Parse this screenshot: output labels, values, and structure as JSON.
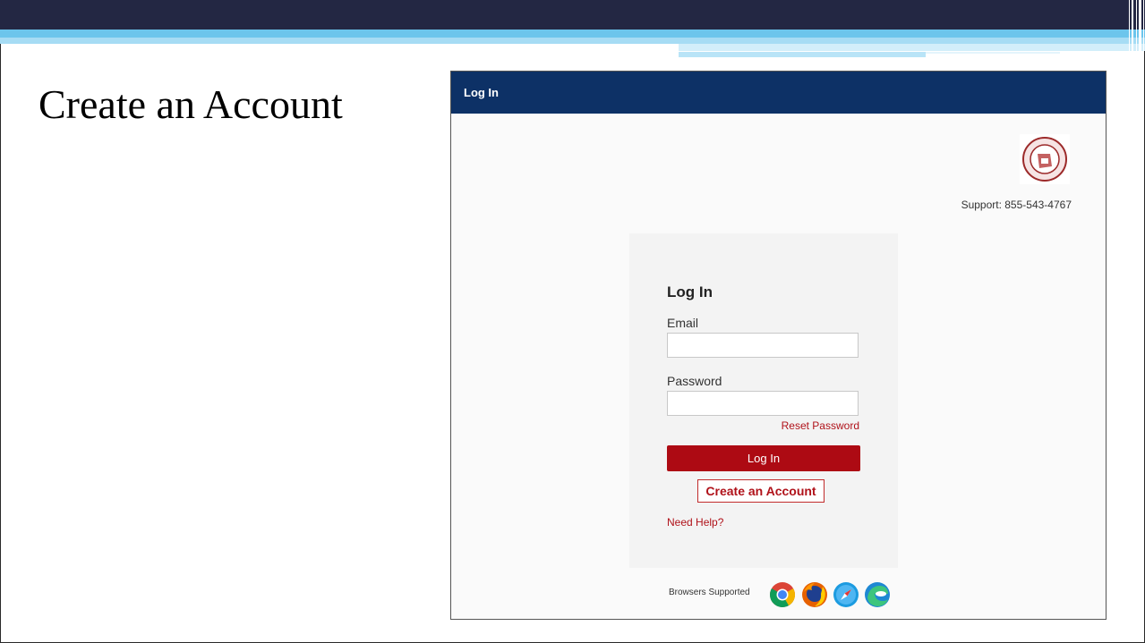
{
  "slide": {
    "title": "Create an Account"
  },
  "app": {
    "header_title": "Log In",
    "support_text": "Support: 855-543-4767",
    "login_form": {
      "title": "Log In",
      "email_label": "Email",
      "email_value": "",
      "password_label": "Password",
      "password_value": "",
      "reset_link": "Reset Password",
      "login_button": "Log In",
      "create_account_button": "Create an Account",
      "help_link": "Need Help?"
    },
    "browsers": {
      "label": "Browsers Supported",
      "icons": [
        "chrome-icon",
        "firefox-icon",
        "safari-icon",
        "edge-icon"
      ]
    }
  },
  "colors": {
    "header_bg": "#0d3166",
    "primary_red": "#ad0a13",
    "slide_top_bar": "#232743",
    "slide_accent": "#6cc5ec"
  }
}
